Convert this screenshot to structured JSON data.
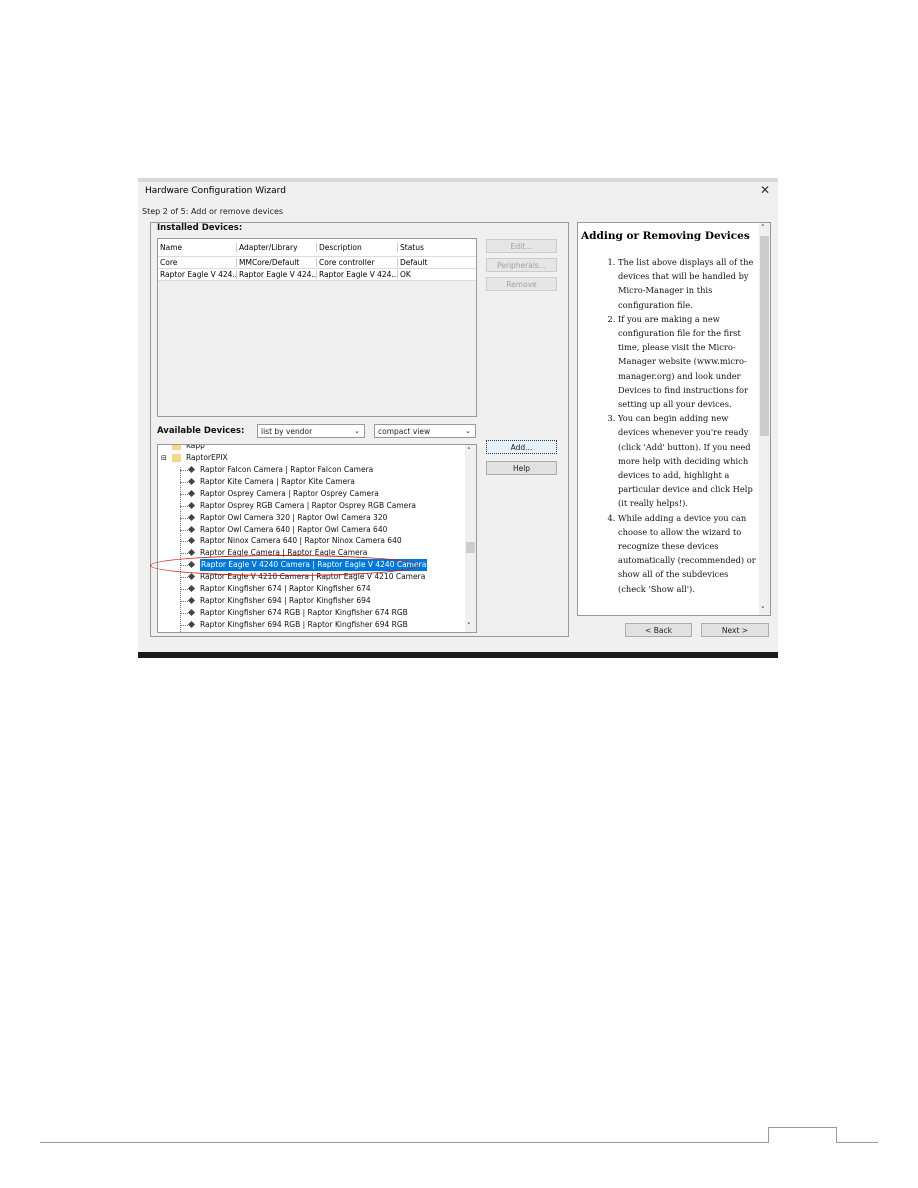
{
  "window": {
    "title": "Hardware Configuration Wizard",
    "close_icon": "close-icon",
    "step": "Step 2 of 5: Add or remove devices"
  },
  "installed": {
    "label": "Installed Devices:",
    "columns": [
      "Name",
      "Adapter/Library",
      "Description",
      "Status"
    ],
    "rows": [
      [
        "Core",
        "MMCore/Default",
        "Core controller",
        "Default"
      ],
      [
        "Raptor Eagle V 424...",
        "Raptor Eagle V 424...",
        "Raptor Eagle V 424...",
        "OK"
      ]
    ]
  },
  "buttons": {
    "edit": "Edit...",
    "peripherals": "Peripherals...",
    "remove": "Remove",
    "add": "Add...",
    "help": "Help",
    "back": "< Back",
    "next": "Next >"
  },
  "available": {
    "label": "Available Devices:",
    "list_mode": "list by vendor",
    "view_mode": "compact view",
    "tree": {
      "folders": [
        "Kapp",
        "RaptorEPIX"
      ],
      "items": [
        "Raptor Falcon Camera | Raptor Falcon Camera",
        "Raptor Kite Camera | Raptor Kite Camera",
        "Raptor Osprey Camera | Raptor Osprey Camera",
        "Raptor Osprey RGB Camera | Raptor Osprey RGB Camera",
        "Raptor Owl Camera 320 | Raptor Owl Camera 320",
        "Raptor Owl Camera 640 | Raptor Owl Camera 640",
        "Raptor Ninox Camera 640 | Raptor Ninox Camera 640",
        "Raptor Eagle Camera | Raptor Eagle Camera",
        "Raptor Eagle V 4240 Camera | Raptor Eagle V 4240 Camera",
        "Raptor Eagle V 4210 Camera | Raptor Eagle V 4210 Camera",
        "Raptor Kingfisher 674 | Raptor Kingfisher 674",
        "Raptor Kingfisher 694 | Raptor Kingfisher 694",
        "Raptor Kingfisher 674 RGB | Raptor Kingfisher 674 RGB",
        "Raptor Kingfisher 694 RGB | Raptor Kingfisher 694 RGB"
      ],
      "selected": "Raptor Eagle V 4240 Camera | Raptor Eagle V 4240 Camera"
    }
  },
  "help_panel": {
    "heading": "Adding or Removing Devices",
    "items": [
      "The list above displays all of the devices that will be handled by Micro-Manager in this configuration file.",
      "If you are making a new configuration file for the first time, please visit the Micro-Manager website (www.micro-manager.org) and look under Devices to find instructions for setting up all your devices.",
      "You can begin adding new devices whenever you're ready (click 'Add' button). If you need more help with deciding which devices to add, highlight a particular device and click Help (it really helps!).",
      "While adding a device you can choose to allow the wizard to recognize these devices automatically (recommended) or show all of the subdevices (check 'Show all')."
    ]
  },
  "colors": {
    "selection": "#0078d7",
    "annotation_oval": "#d01818"
  }
}
